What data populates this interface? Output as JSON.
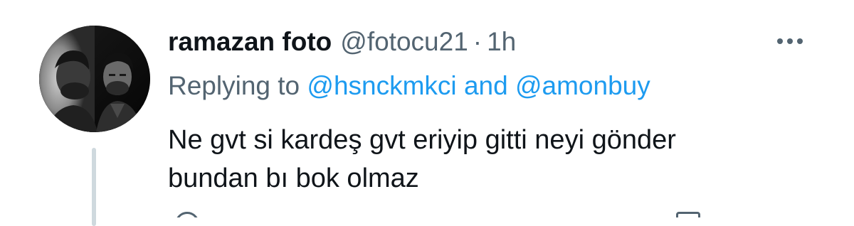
{
  "tweet": {
    "display_name": "ramazan foto",
    "handle": "@fotocu21",
    "separator": "·",
    "time": "1h",
    "replying_prefix": "Replying to",
    "reply_to_1": "@hsnckmkci",
    "reply_conjunction": "and",
    "reply_to_2": "@amonbuy",
    "text_lines": [
      "Ne gvt si kardeş gvt eriyip gitti neyi gönder",
      "bundan bı bok olmaz"
    ]
  },
  "icons": {
    "more": "more-horizontal-icon",
    "reply": "reply-icon",
    "share": "share-icon"
  },
  "colors": {
    "primary_text": "#0f1419",
    "secondary_text": "#536471",
    "link": "#1d9bf0",
    "thread_line": "#cfd9de"
  }
}
